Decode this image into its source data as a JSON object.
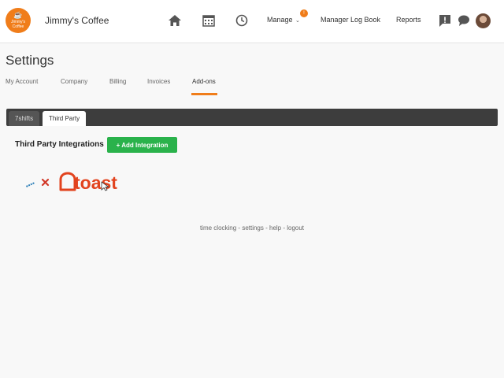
{
  "header": {
    "logo": {
      "line1": "Jimmy's",
      "line2": "Coffee"
    },
    "brand_name": "Jimmy's Coffee",
    "nav": {
      "manage_label": "Manage",
      "manage_badge": "!",
      "logbook_label": "Manager Log Book",
      "reports_label": "Reports"
    },
    "icons": [
      "home-icon",
      "calendar-icon",
      "clock-icon",
      "alert-icon",
      "chat-icon",
      "avatar"
    ]
  },
  "page": {
    "title": "Settings",
    "subnav": [
      {
        "label": "My Account"
      },
      {
        "label": "Company"
      },
      {
        "label": "Billing"
      },
      {
        "label": "Invoices"
      },
      {
        "label": "Add-ons",
        "active": true
      }
    ]
  },
  "tabs": [
    {
      "label": "7shifts"
    },
    {
      "label": "Third Party",
      "active": true
    }
  ],
  "integrations": {
    "title": "Third Party Integrations",
    "add_button": "+ Add Integration",
    "items": [
      {
        "partner_left_icon": "7shifts-logo-icon",
        "separator": "×",
        "partner_right": "toast"
      }
    ]
  },
  "footer": {
    "links": [
      "time clocking",
      "settings",
      "help",
      "logout"
    ],
    "separator": " - "
  },
  "colors": {
    "accent": "#f07d1a",
    "button_green": "#2ab24b",
    "toast_red": "#e2431e",
    "tabbar_dark": "#3d3d3d"
  }
}
